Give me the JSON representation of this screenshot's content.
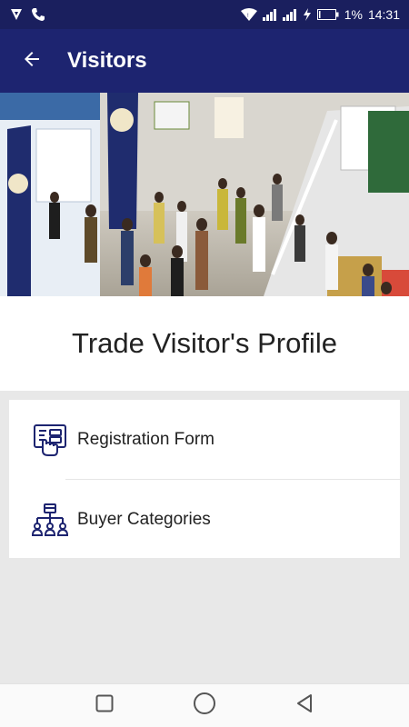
{
  "status_bar": {
    "battery_percent": "1%",
    "time": "14:31",
    "icons": [
      "shield-icon",
      "phone-icon",
      "wifi-icon",
      "signal-icon",
      "signal-icon",
      "charging-icon",
      "battery-icon"
    ]
  },
  "app_bar": {
    "title": "Visitors",
    "back_icon": "arrow-left-icon"
  },
  "hero": {
    "image": "trade-fair-crowd-photo"
  },
  "profile": {
    "title": "Trade Visitor's Profile"
  },
  "menu": {
    "items": [
      {
        "label": "Registration Form",
        "icon": "registration-form-icon"
      },
      {
        "label": "Buyer Categories",
        "icon": "org-chart-icon"
      }
    ]
  },
  "nav_bar": {
    "icons": [
      "recent-apps-icon",
      "home-icon",
      "back-triangle-icon"
    ]
  },
  "colors": {
    "status_bar": "#1a1f5e",
    "app_bar": "#1d2470",
    "accent_icon": "#1d2470",
    "background": "#e8e8e8"
  }
}
